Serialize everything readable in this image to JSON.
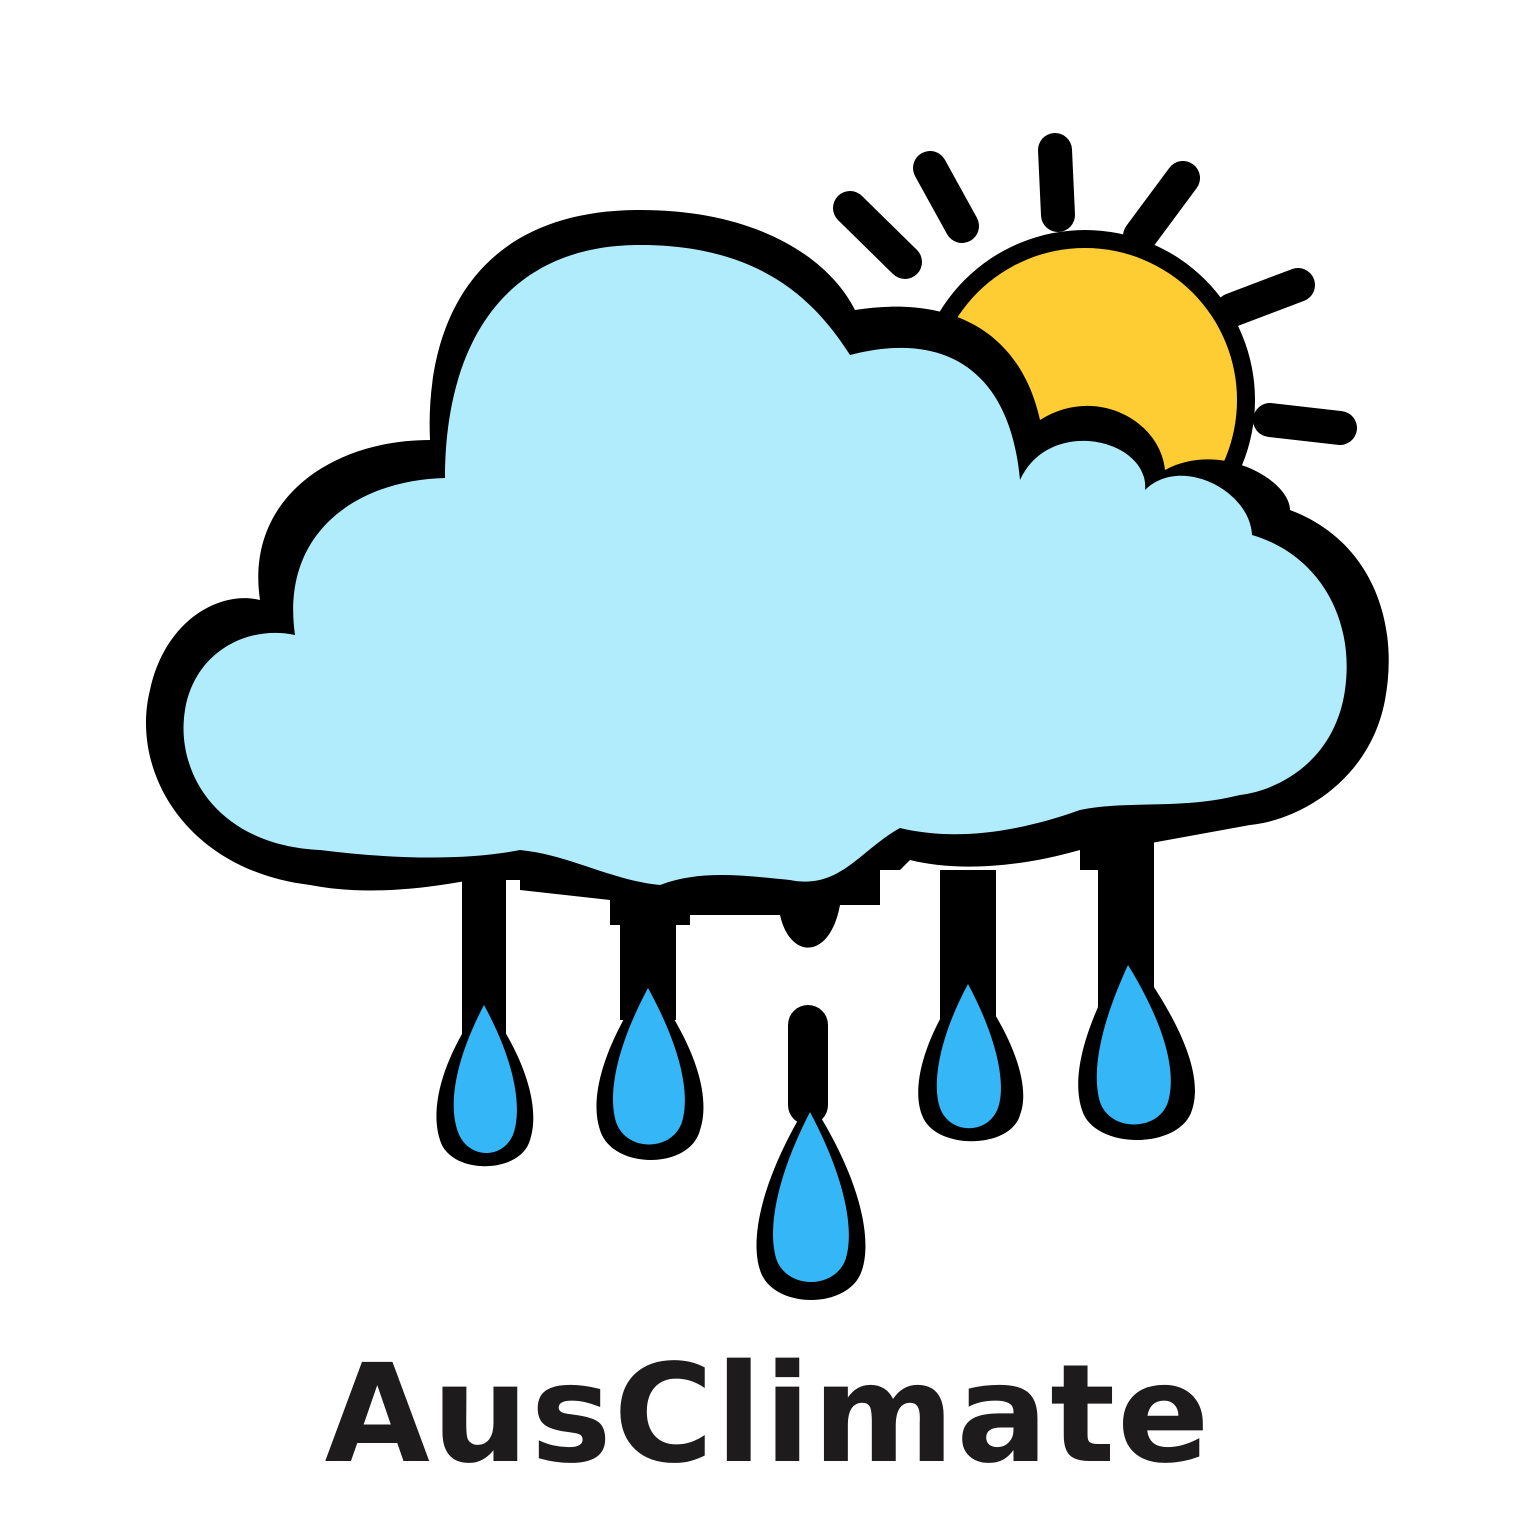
{
  "brand": {
    "name": "AusClimate"
  },
  "icons": {
    "main": "cloud-rain-sun-icon"
  },
  "colors": {
    "outline": "#000000",
    "cloud": "#b0ecfc",
    "sun": "#fecd33",
    "raindrop": "#35b7f7",
    "text": "#1d1b1c",
    "background": "#ffffff"
  }
}
